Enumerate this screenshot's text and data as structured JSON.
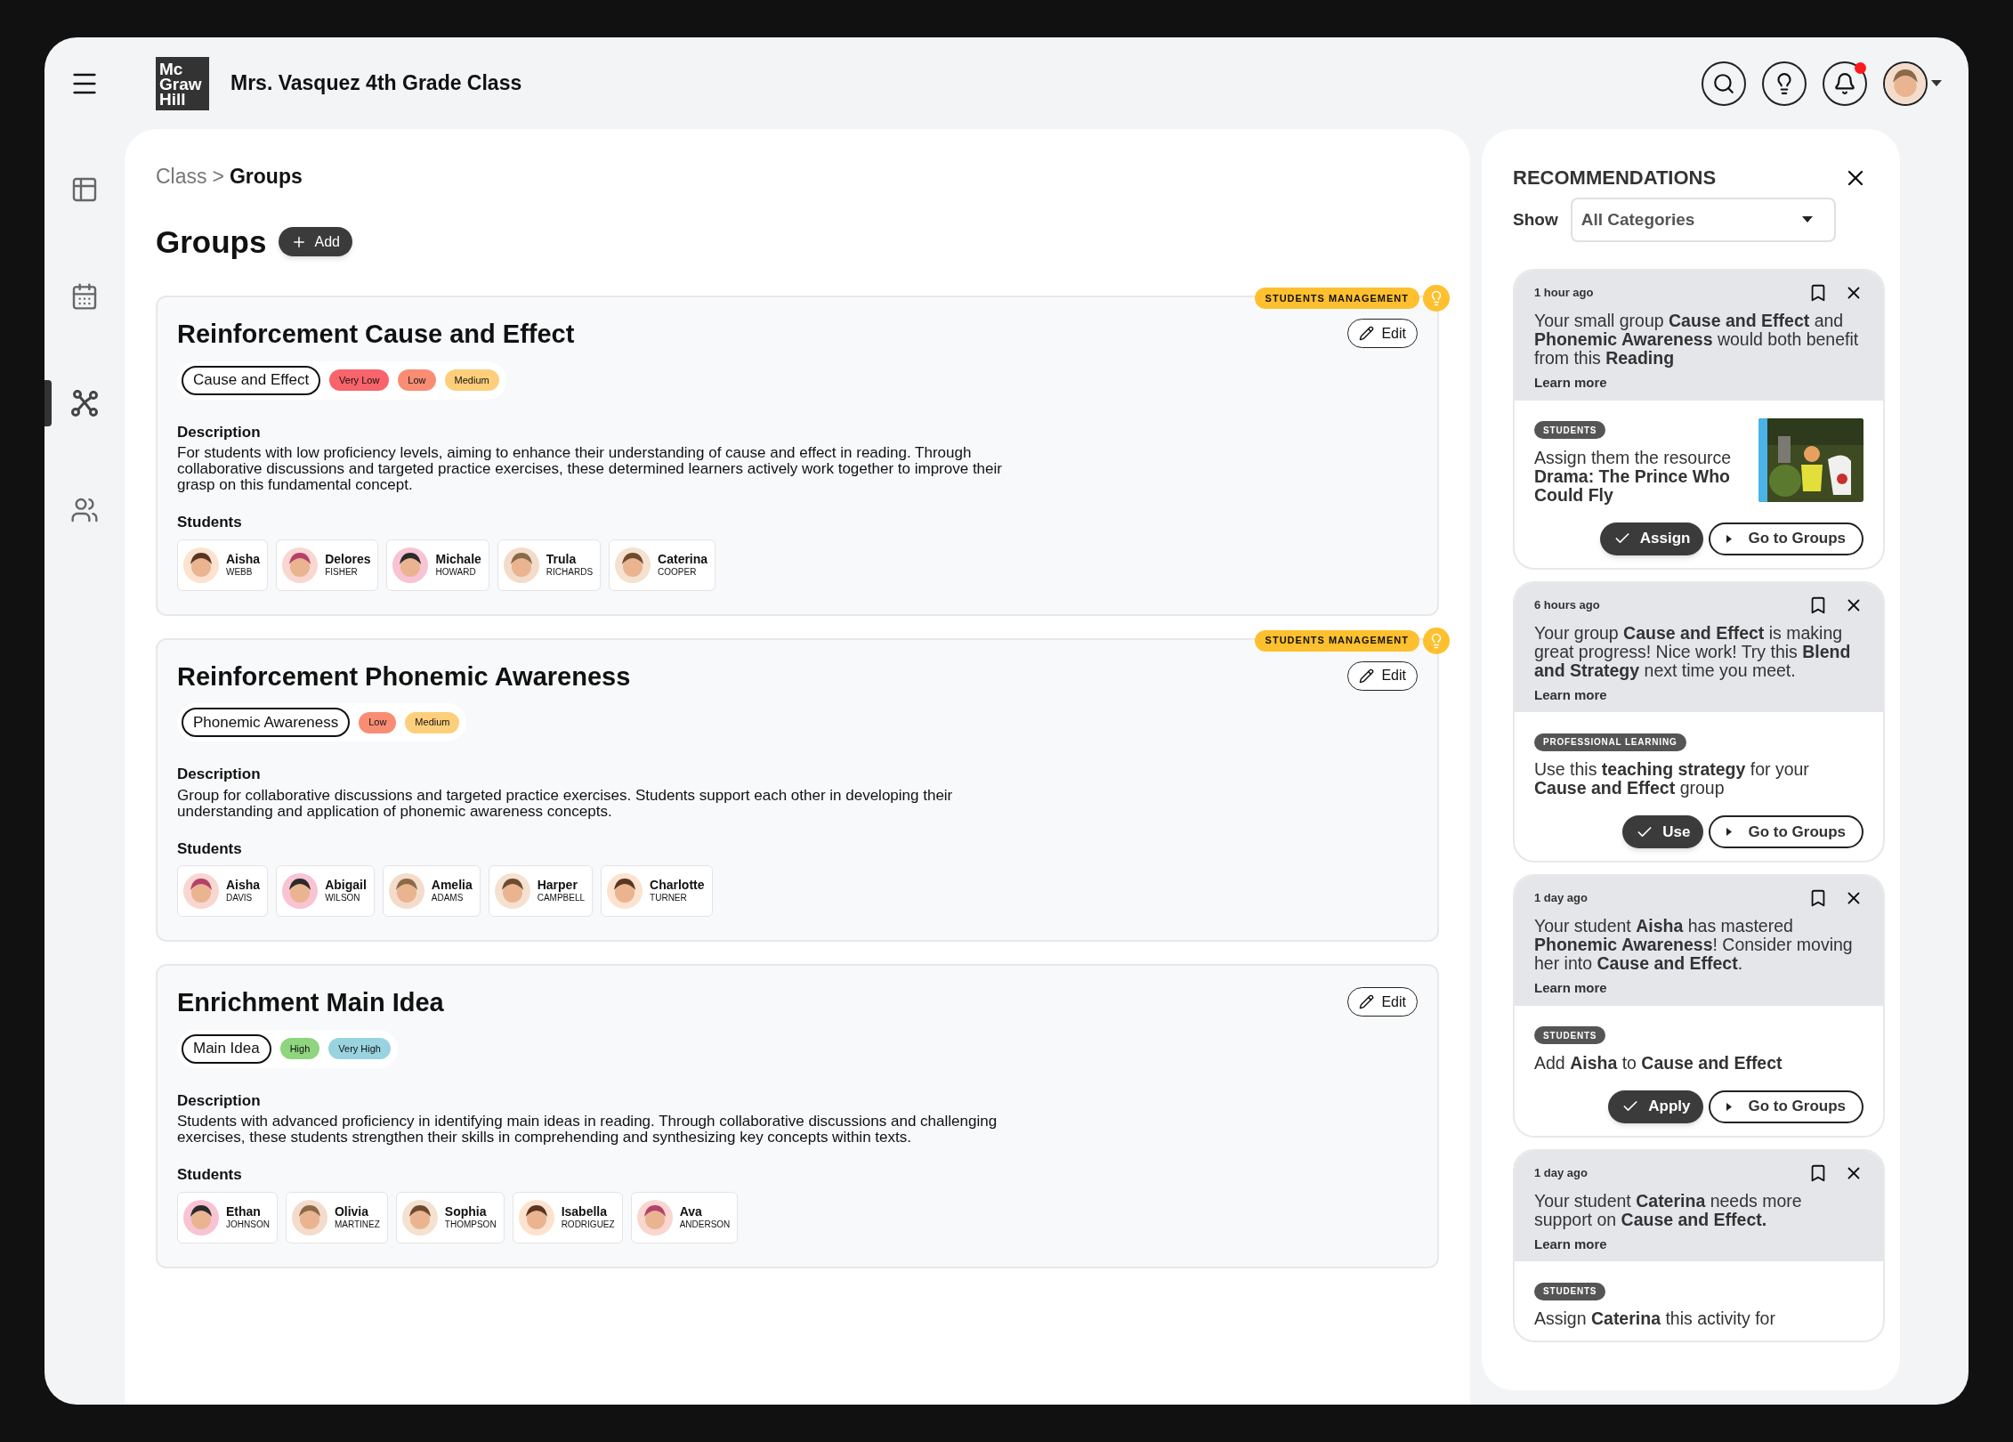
{
  "header": {
    "logo": [
      "Mc",
      "Graw",
      "Hill"
    ],
    "title": "Mrs. Vasquez 4th Grade Class",
    "has_notification": true
  },
  "sidebar": {
    "items": [
      {
        "kind": "table",
        "selected": false
      },
      {
        "kind": "calendar",
        "selected": false
      },
      {
        "kind": "groups-graph",
        "selected": true
      },
      {
        "kind": "people",
        "selected": false
      }
    ]
  },
  "breadcrumb": {
    "parent": "Class",
    "separator": ">",
    "current": "Groups"
  },
  "page_title": "Groups",
  "add_button": "Add",
  "groups": [
    {
      "title": "Reinforcement Cause and Effect",
      "badge": "STUDENTS MANAGEMENT",
      "edit": "Edit",
      "tags": [
        {
          "kind": "subject",
          "label": "Cause and Effect"
        },
        {
          "kind": "level",
          "label": "Very Low",
          "color": "#f8646b"
        },
        {
          "kind": "level",
          "label": "Low",
          "color": "#f98d73"
        },
        {
          "kind": "level",
          "label": "Medium",
          "color": "#fdcf7b"
        }
      ],
      "description_label": "Description",
      "description": "For students with low proficiency levels, aiming to enhance their understanding of cause and effect in reading. Through collaborative discussions and targeted practice exercises, these determined learners actively work together to improve their grasp on this fundamental concept.",
      "students_label": "Students",
      "students": [
        {
          "first": "Aisha",
          "last": "WEBB"
        },
        {
          "first": "Delores",
          "last": "FISHER"
        },
        {
          "first": "Michale",
          "last": "HOWARD"
        },
        {
          "first": "Trula",
          "last": "RICHARDS"
        },
        {
          "first": "Caterina",
          "last": "COOPER"
        }
      ]
    },
    {
      "title": "Reinforcement Phonemic Awareness",
      "badge": "STUDENTS MANAGEMENT",
      "edit": "Edit",
      "tags": [
        {
          "kind": "subject",
          "label": "Phonemic Awareness"
        },
        {
          "kind": "level",
          "label": "Low",
          "color": "#f98d73"
        },
        {
          "kind": "level",
          "label": "Medium",
          "color": "#fdcf7b"
        }
      ],
      "description_label": "Description",
      "description": "Group for collaborative discussions and targeted practice exercises. Students  support each other in developing their understanding and application of phonemic awareness concepts.",
      "students_label": "Students",
      "students": [
        {
          "first": "Aisha",
          "last": "DAVIS"
        },
        {
          "first": "Abigail",
          "last": "WILSON"
        },
        {
          "first": "Amelia",
          "last": "ADAMS"
        },
        {
          "first": "Harper",
          "last": "CAMPBELL"
        },
        {
          "first": "Charlotte",
          "last": "TURNER"
        }
      ]
    },
    {
      "title": "Enrichment Main Idea",
      "edit": "Edit",
      "tags": [
        {
          "kind": "subject",
          "label": "Main Idea"
        },
        {
          "kind": "level",
          "label": "High",
          "color": "#8fd57f"
        },
        {
          "kind": "level",
          "label": "Very High",
          "color": "#9ad3e0"
        }
      ],
      "description_label": "Description",
      "description": "Students with advanced proficiency in identifying main ideas in reading. Through collaborative discussions and challenging exercises, these students strengthen their skills in comprehending and synthesizing key concepts within texts.",
      "students_label": "Students",
      "students": [
        {
          "first": "Ethan",
          "last": "JOHNSON"
        },
        {
          "first": "Olivia",
          "last": "MARTINEZ"
        },
        {
          "first": "Sophia",
          "last": "THOMPSON"
        },
        {
          "first": "Isabella",
          "last": "RODRIGUEZ"
        },
        {
          "first": "Ava",
          "last": "ANDERSON"
        }
      ]
    }
  ],
  "recommendations": {
    "title": "RECOMMENDATIONS",
    "show_label": "Show",
    "filter": "All Categories",
    "cards": [
      {
        "time": "1 hour ago",
        "message": "Your small group **Cause and Effect** and **Phonemic Awareness** would both benefit from this **Reading**",
        "learn_more": "Learn more",
        "category": "STUDENTS",
        "action_text": "Assign them the resource **Drama: The Prince Who Could Fly**",
        "primary": "Assign",
        "secondary": "Go to Groups"
      },
      {
        "time": "6 hours ago",
        "message": "Your group **Cause and Effect** is making great progress! Nice work! Try this **Blend and Strategy** next time you meet.",
        "learn_more": "Learn more",
        "category": "PROFESSIONAL LEARNING",
        "action_text": "Use this **teaching strategy** for your **Cause and Effect** group",
        "primary": "Use",
        "secondary": "Go to Groups"
      },
      {
        "time": "1 day ago",
        "message": "Your student **Aisha** has mastered **Phonemic Awareness**! Consider moving her into **Cause and Effect**.",
        "learn_more": "Learn more",
        "category": "STUDENTS",
        "action_text": "Add **Aisha** to **Cause and Effect**",
        "primary": "Apply",
        "secondary": "Go to Groups"
      },
      {
        "time": "1 day ago",
        "message": "Your student **Caterina** needs more support on **Cause and Effect.**",
        "learn_more": "Learn more",
        "category": "STUDENTS",
        "action_text": "Assign **Caterina** this activity for"
      }
    ]
  }
}
